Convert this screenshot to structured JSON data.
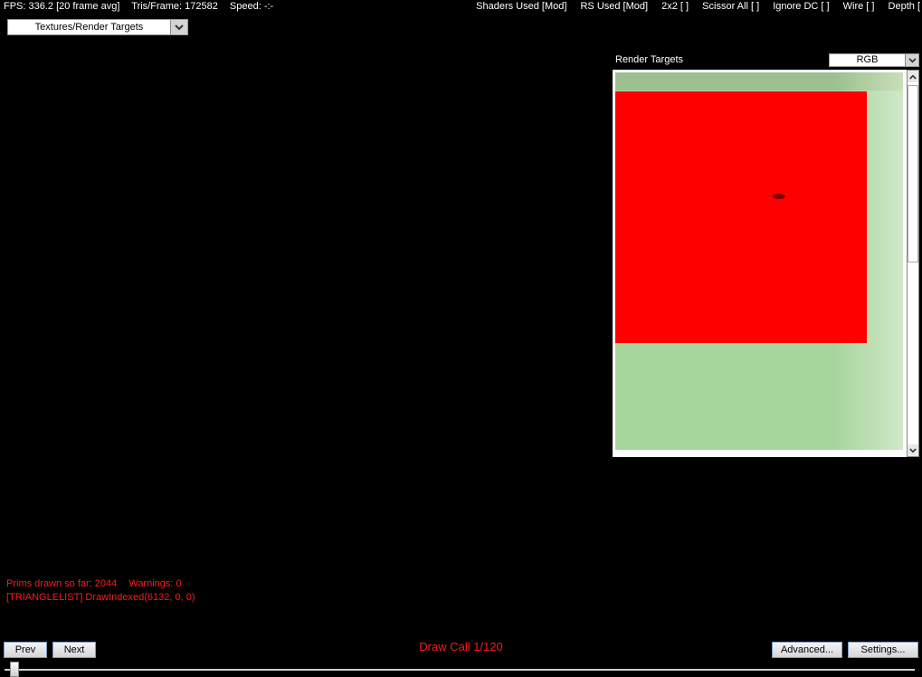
{
  "status": {
    "fps": "FPS: 336.2 [20 frame avg]",
    "tris": "Tris/Frame:  172582",
    "speed": "Speed:  -:-",
    "shaders": "Shaders Used [Mod]",
    "rs": "RS Used [Mod]",
    "two_by_two": "2x2 [ ]",
    "scissor": "Scissor All [ ]",
    "ignore_dc": "Ignore DC [ ]",
    "wire": "Wire [ ]",
    "depth": "Depth ["
  },
  "view_select": {
    "value": "Textures/Render Targets"
  },
  "render_targets": {
    "label": "Render Targets",
    "channel_value": "RGB"
  },
  "log": {
    "prims": "Prims drawn so far: 2044",
    "warnings": "Warnings: 0",
    "call": "[TRIANGLELIST] DrawIndexed(6132, 0, 0)"
  },
  "draw_call": "Draw Call 1/120",
  "buttons": {
    "prev": "Prev",
    "next": "Next",
    "advanced": "Advanced...",
    "settings": "Settings..."
  },
  "slider": {
    "value": 1,
    "max": 120
  },
  "icons": {
    "dropdown": "chevron-down-icon",
    "scroll_up": "arrow-up-icon",
    "scroll_down": "arrow-down-icon"
  }
}
